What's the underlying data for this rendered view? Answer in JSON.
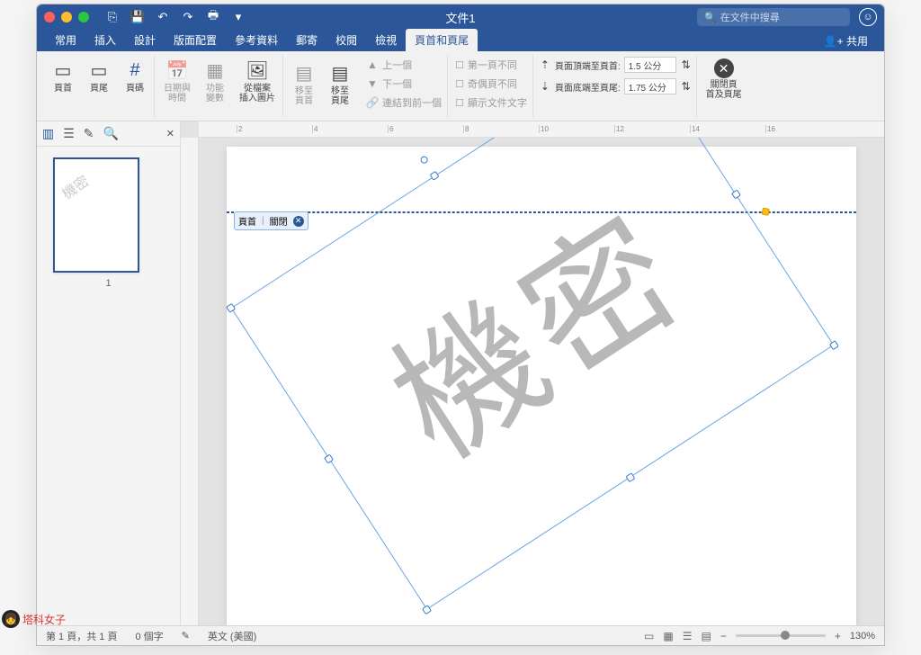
{
  "titlebar": {
    "doc_title": "文件1",
    "search_placeholder": "在文件中搜尋"
  },
  "tabs": {
    "items": [
      "常用",
      "插入",
      "設計",
      "版面配置",
      "參考資料",
      "郵寄",
      "校閱",
      "檢視",
      "頁首和頁尾"
    ],
    "active_index": 8,
    "share": "共用"
  },
  "ribbon": {
    "header": "頁首",
    "footer": "頁尾",
    "page_number": "頁碼",
    "date_time": "日期與\n時間",
    "doc_info": "功能\n變數",
    "from_file": "從檔案\n插入圖片",
    "goto_header": "移至\n頁首",
    "goto_footer": "移至\n頁尾",
    "prev": "上一個",
    "next": "下一個",
    "link_prev": "連結到前一個",
    "diff_first": "第一頁不同",
    "diff_oddeven": "奇偶頁不同",
    "show_doc_text": "顯示文件文字",
    "header_from_top_label": "頁面頂端至頁首:",
    "header_from_top_value": "1.5 公分",
    "footer_from_bottom_label": "頁面底端至頁尾:",
    "footer_from_bottom_value": "1.75 公分",
    "close": "關閉頁\n首及頁尾"
  },
  "side": {
    "thumb_number": "1"
  },
  "page": {
    "watermark_text": "機密",
    "header_tag_label": "頁首",
    "header_tag_close": "關閉"
  },
  "status": {
    "page_info": "第 1 頁，共 1 頁",
    "word_count": "0 個字",
    "language": "英文 (美國)",
    "zoom": "130%"
  },
  "brand": "塔科女子"
}
